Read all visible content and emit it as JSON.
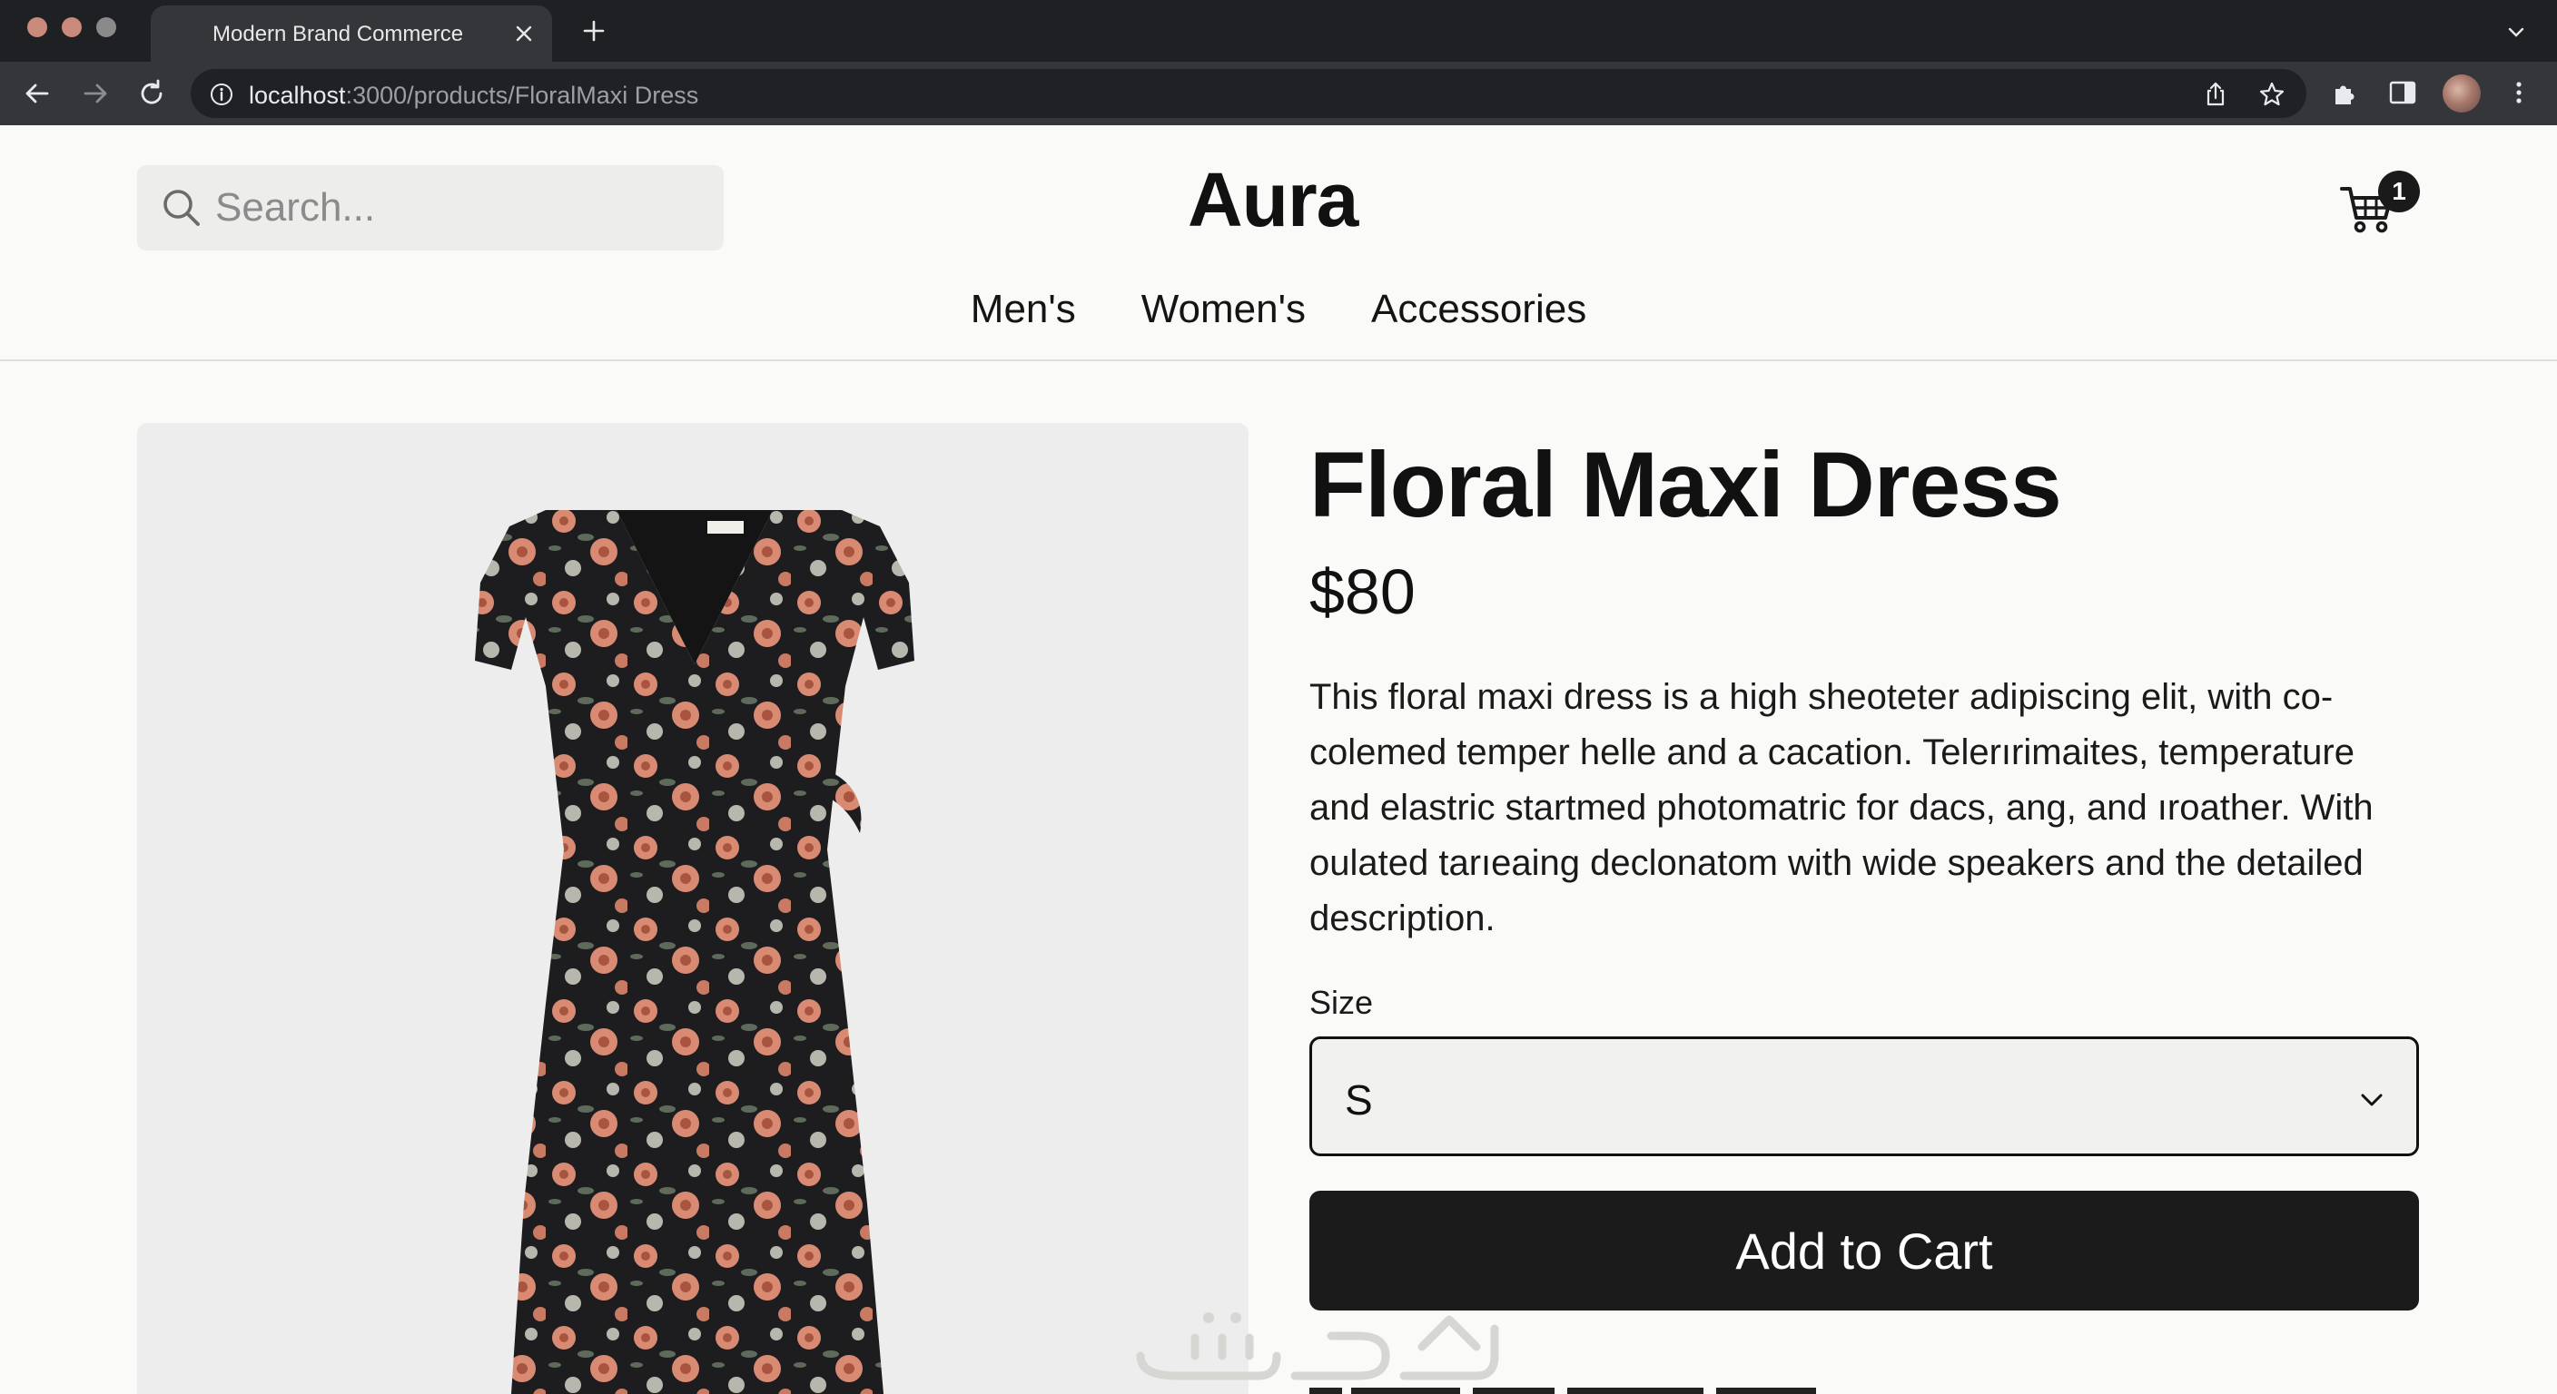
{
  "browser": {
    "tab_title": "Modern Brand Commerce",
    "url_host": "localhost",
    "url_path": ":3000/products/FloralMaxi Dress"
  },
  "header": {
    "search_placeholder": "Search...",
    "logo": "Aura",
    "cart_count": "1",
    "nav": [
      "Men's",
      "Women's",
      "Accessories"
    ]
  },
  "product": {
    "title": "Floral Maxi Dress",
    "price": "$80",
    "description": "This floral maxi dress is a high sheoteter adipiscing elit, with co-colemed temper helle and a cacation. Telerırimaites, temperature and elastric startmed photomatric for dacs, ang, and ıroather. With oulated tarıeaing declonatom with wide speakers and the detailed description.",
    "size_label": "Size",
    "size_selected": "S",
    "add_to_cart": "Add to Cart"
  },
  "colors": {
    "dress_base": "#1d1d1f",
    "flower_coral": "#d98a72",
    "flower_pale": "#b7b7ae",
    "accent_button": "#1b1b1b"
  }
}
